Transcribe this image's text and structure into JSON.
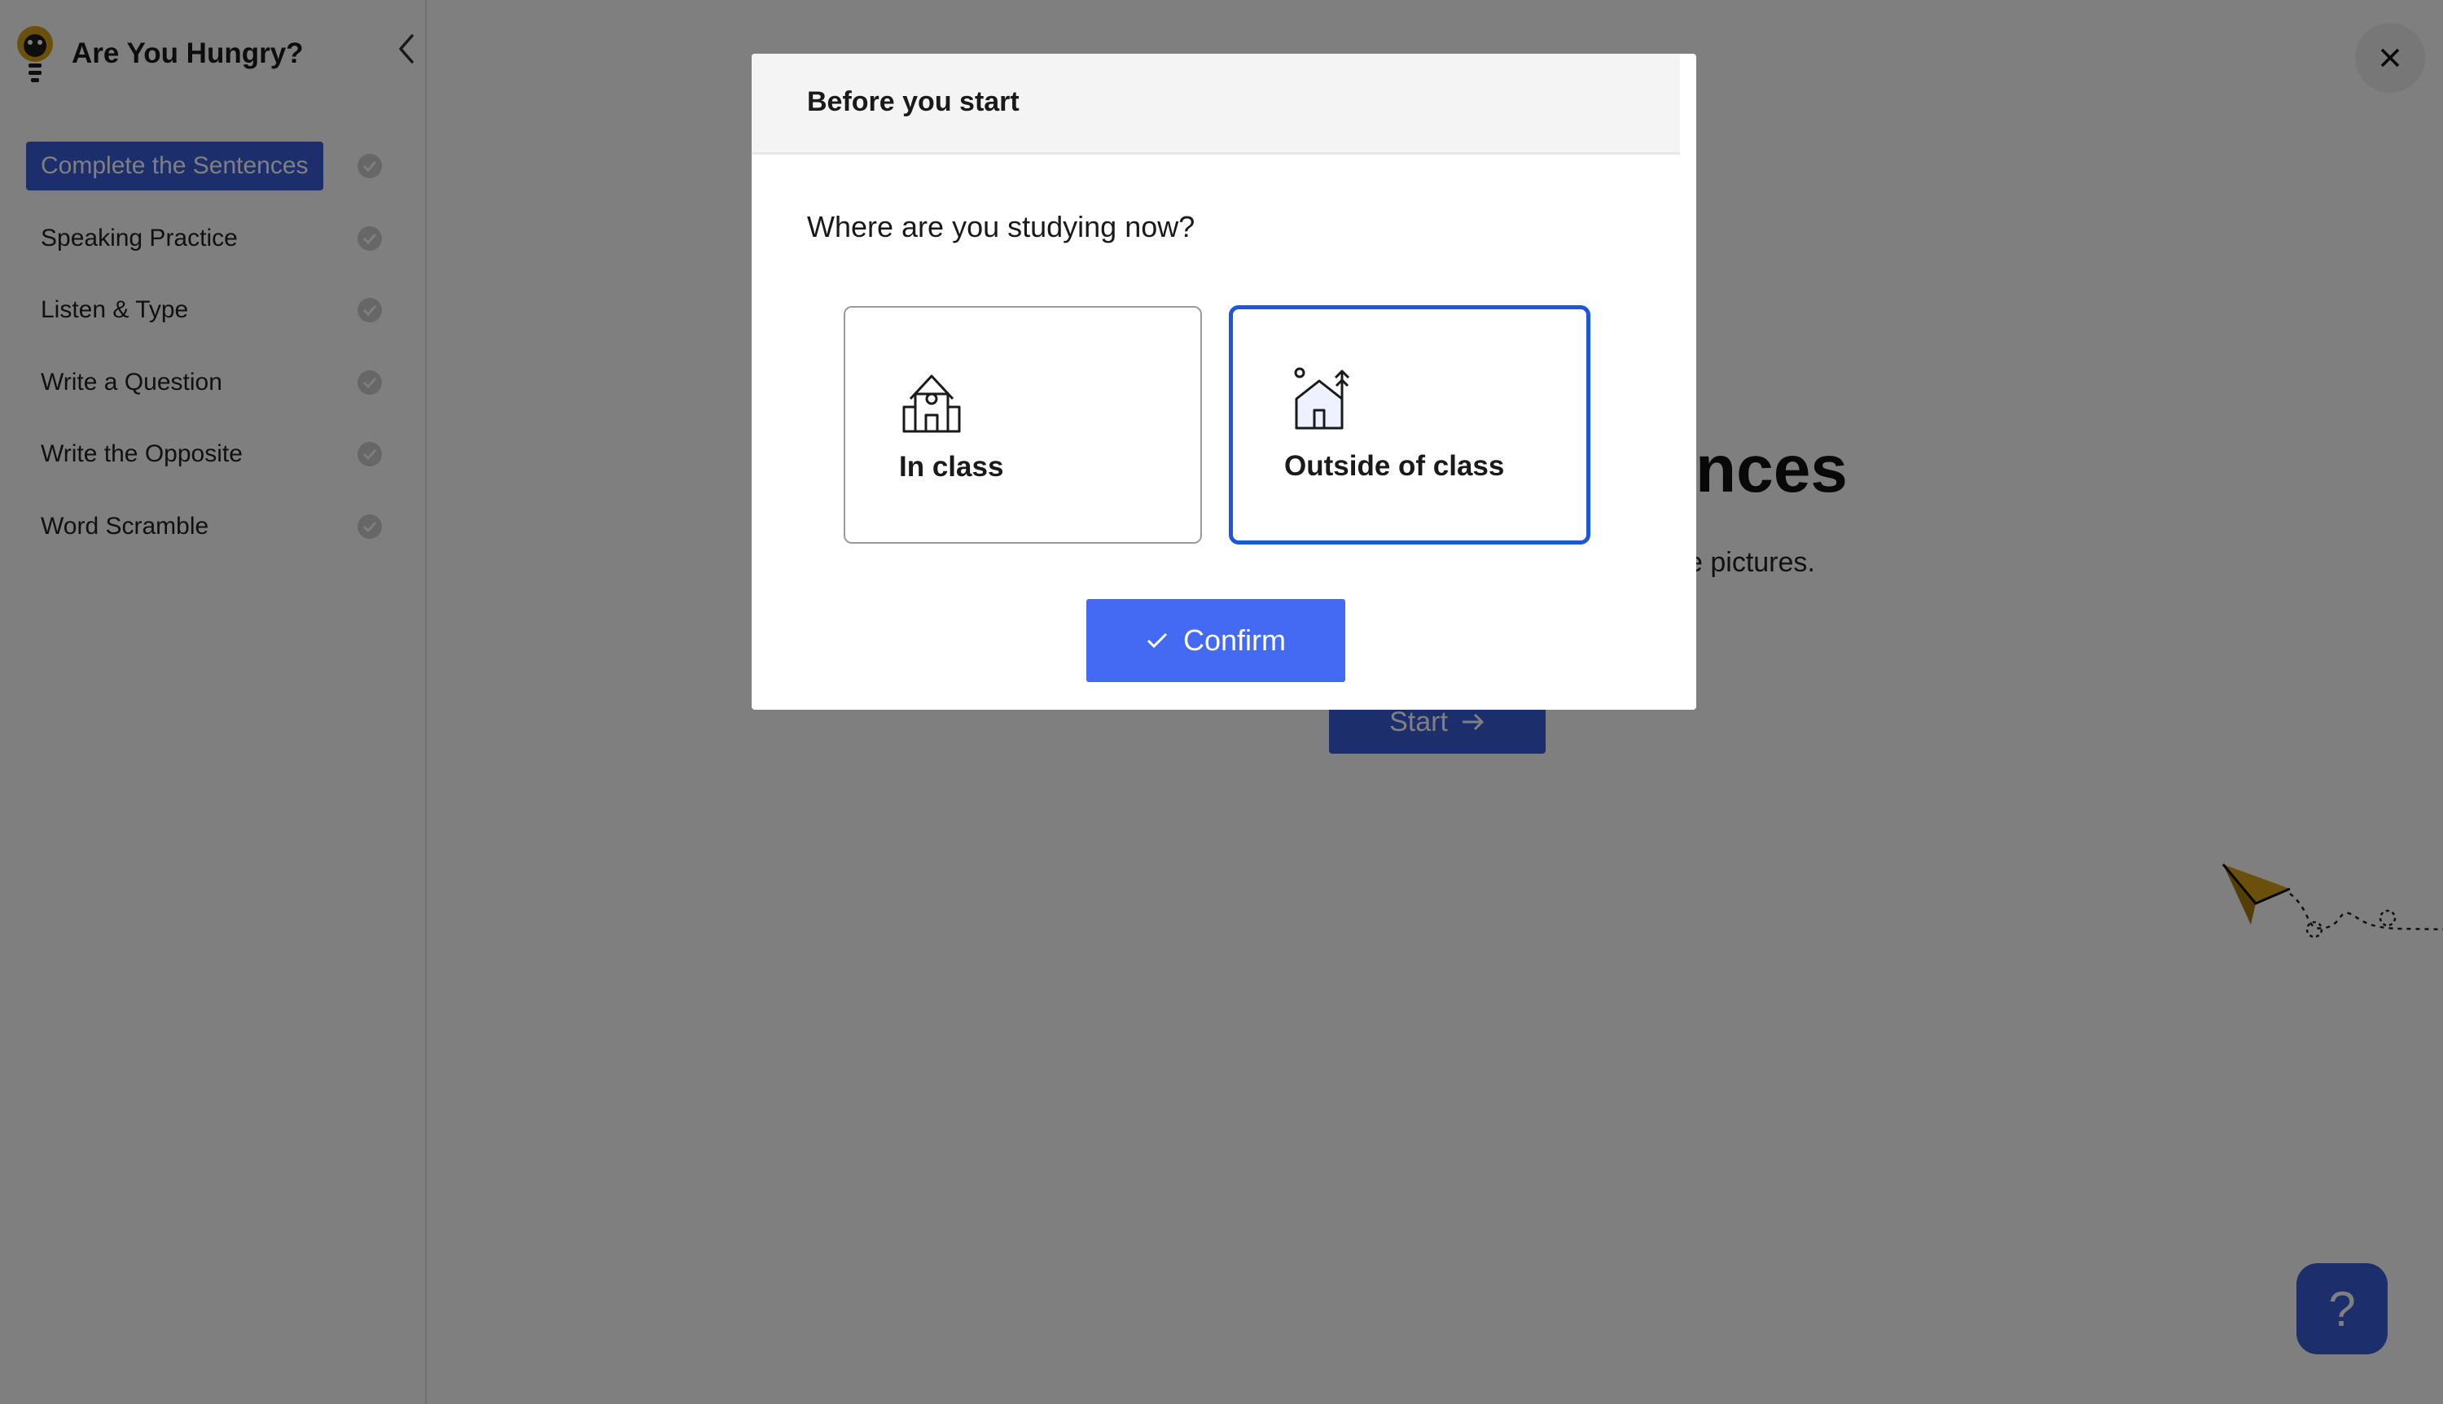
{
  "sidebar": {
    "title": "Are You Hungry?",
    "items": [
      {
        "label": "Complete the Sentences",
        "active": true
      },
      {
        "label": "Speaking Practice",
        "active": false
      },
      {
        "label": "Listen & Type",
        "active": false
      },
      {
        "label": "Write a Question",
        "active": false
      },
      {
        "label": "Write the Opposite",
        "active": false
      },
      {
        "label": "Word Scramble",
        "active": false
      }
    ]
  },
  "main": {
    "title_visible": "nces",
    "subtitle_visible": "e pictures.",
    "start_label": "Start",
    "help_label": "?"
  },
  "modal": {
    "title": "Before you start",
    "question": "Where are you studying now?",
    "options": [
      {
        "label": "In class",
        "icon": "school-building-icon",
        "selected": false
      },
      {
        "label": "Outside of class",
        "icon": "house-outdoors-icon",
        "selected": true
      }
    ],
    "confirm_label": "Confirm"
  },
  "colors": {
    "accent": "#3a5cd8",
    "confirm": "#4469f2",
    "selected_border": "#1d57d8",
    "overlay": "rgba(0,0,0,0.5)",
    "logo": "#d4a017"
  }
}
